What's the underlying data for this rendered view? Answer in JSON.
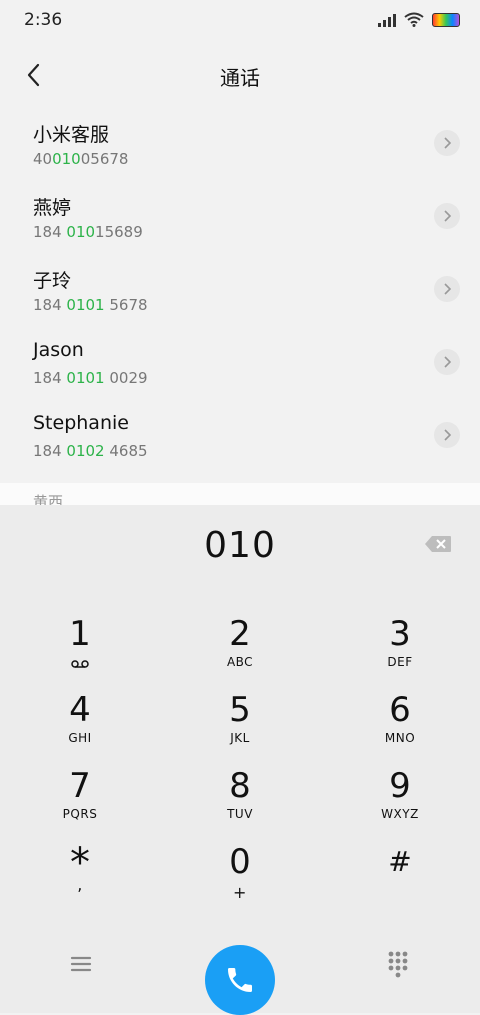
{
  "status": {
    "time": "2:36"
  },
  "header": {
    "title": "通话"
  },
  "contacts": [
    {
      "name": "小米客服",
      "prefix": "40",
      "match": "010",
      "suffix": "05678"
    },
    {
      "name": "燕婷",
      "prefix": "184 ",
      "match": "010",
      "suffix": "15689"
    },
    {
      "name": "子玲",
      "prefix": "184 ",
      "match": "0101",
      "suffix": " 5678"
    },
    {
      "name": "Jason",
      "prefix": "184 ",
      "match": "0101",
      "suffix": " 0029"
    },
    {
      "name": "Stephanie",
      "prefix": "184 ",
      "match": "0102",
      "suffix": " 4685"
    }
  ],
  "next_section_label": "黄西",
  "dialer": {
    "input": "010",
    "keys": [
      {
        "digit": "1",
        "letters": ""
      },
      {
        "digit": "2",
        "letters": "ABC"
      },
      {
        "digit": "3",
        "letters": "DEF"
      },
      {
        "digit": "4",
        "letters": "GHI"
      },
      {
        "digit": "5",
        "letters": "JKL"
      },
      {
        "digit": "6",
        "letters": "MNO"
      },
      {
        "digit": "7",
        "letters": "PQRS"
      },
      {
        "digit": "8",
        "letters": "TUV"
      },
      {
        "digit": "9",
        "letters": "WXYZ"
      },
      {
        "digit": "*",
        "letters": ","
      },
      {
        "digit": "0",
        "letters": "+"
      },
      {
        "digit": "#",
        "letters": ""
      }
    ]
  },
  "icons": {
    "back": "chevron-left-icon",
    "row_action": "chevron-right-icon",
    "delete": "backspace-icon",
    "voicemail": "voicemail-icon",
    "menu": "menu-icon",
    "call": "phone-icon",
    "keypad": "dialpad-icon"
  },
  "colors": {
    "match_highlight": "#2db34a",
    "call_button": "#1a9ff5"
  }
}
